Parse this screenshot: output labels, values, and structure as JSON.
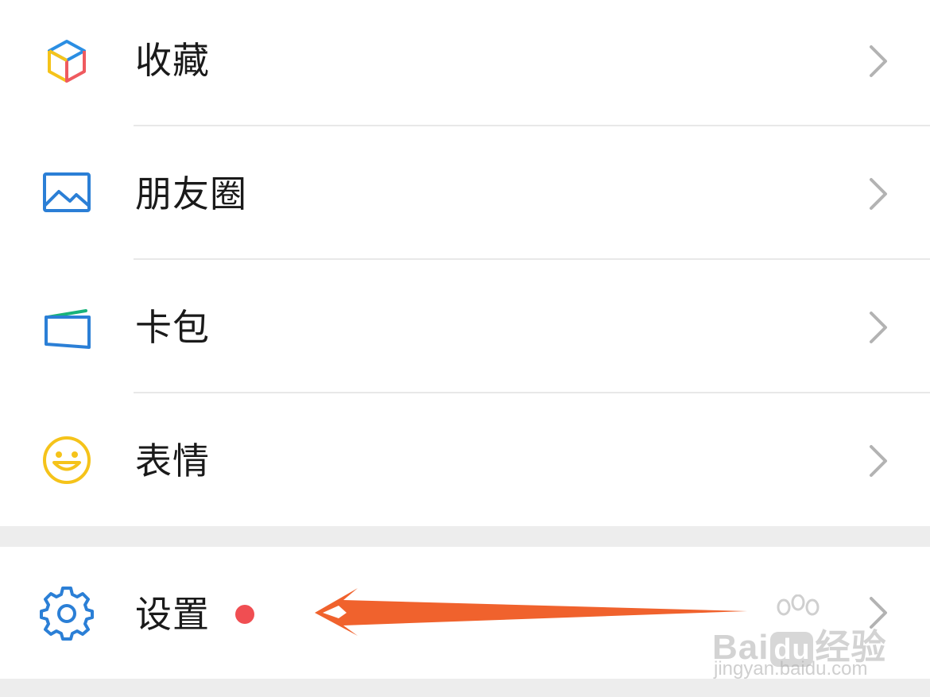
{
  "menu": {
    "items": [
      {
        "label": "收藏",
        "icon": "favorites-cube-icon"
      },
      {
        "label": "朋友圈",
        "icon": "moments-picture-icon"
      },
      {
        "label": "卡包",
        "icon": "card-wallet-icon"
      },
      {
        "label": "表情",
        "icon": "smiley-face-icon"
      }
    ],
    "settings": {
      "label": "设置",
      "icon": "gear-icon",
      "has_badge": true
    }
  },
  "annotation": {
    "type": "arrow",
    "points_to": "settings",
    "color": "#f0622d"
  },
  "watermark": {
    "brand": "Bai",
    "brand_du": "du",
    "brand_suffix": "经验",
    "url": "jingyan.baidu.com"
  },
  "colors": {
    "text": "#1a1a1a",
    "chevron": "#b3b3b3",
    "divider": "#e8e8e8",
    "section_gap": "#ededed",
    "badge": "#f04e52",
    "gear": "#2b7fd6",
    "picture": "#2b7fd6",
    "wallet": "#2b7fd6",
    "smiley": "#f5c31a"
  }
}
